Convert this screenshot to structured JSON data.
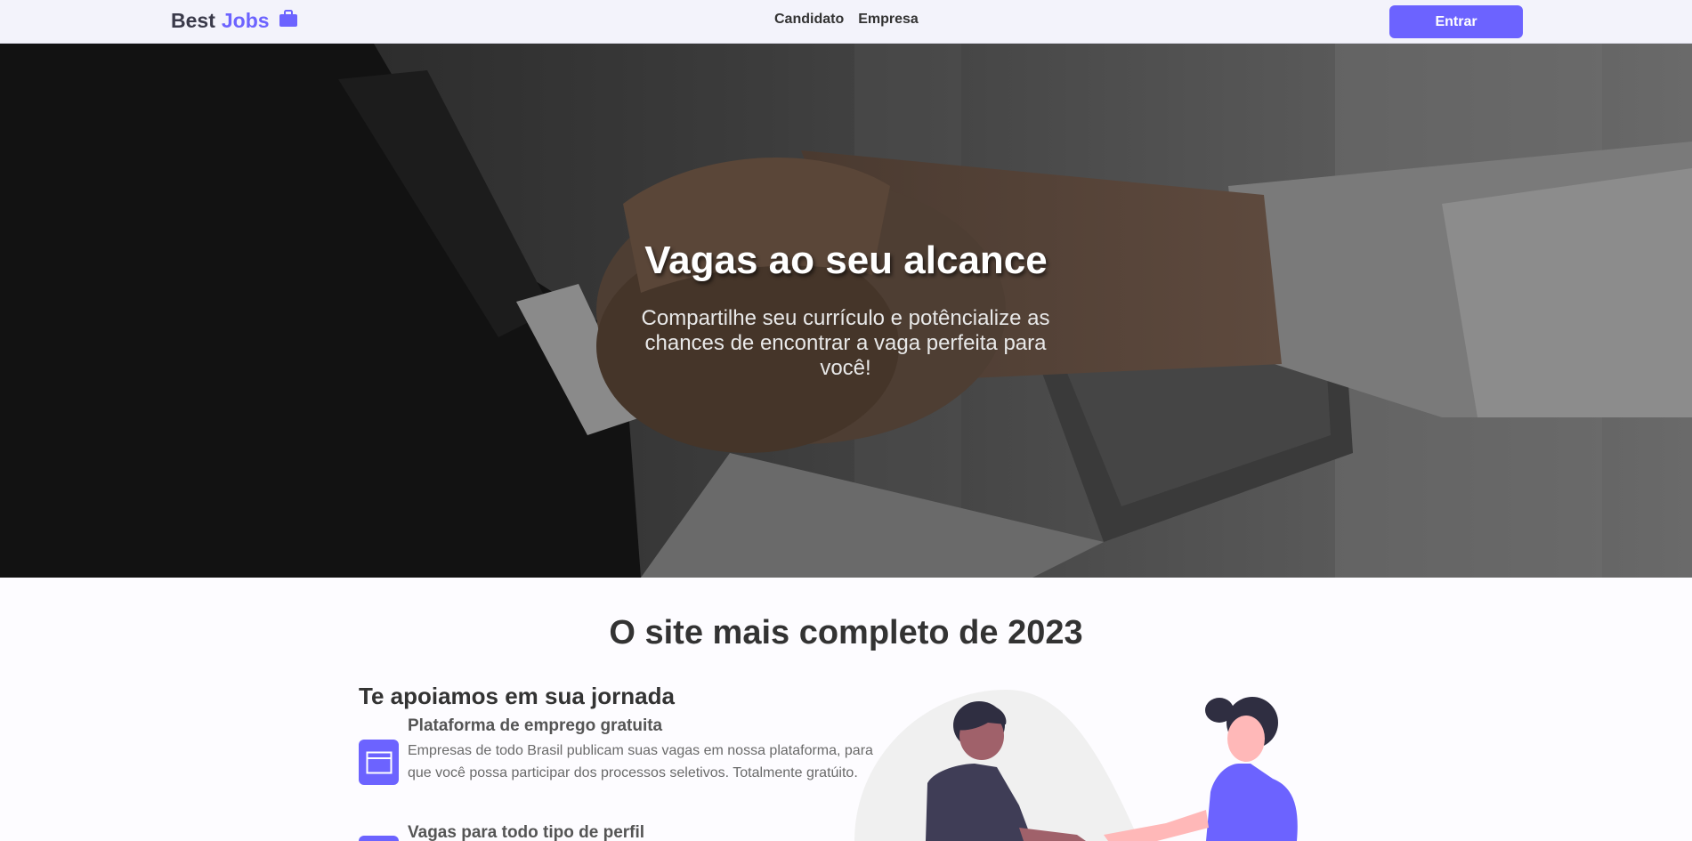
{
  "navbar": {
    "logo_best": "Best",
    "logo_jobs": "Jobs",
    "links": [
      "Candidato",
      "Empresa"
    ],
    "login_label": "Entrar"
  },
  "hero": {
    "title": "Vagas ao seu alcance",
    "subtitle": "Compartilhe seu currículo e potêncialize as chances de encontrar a vaga perfeita para você!"
  },
  "section": {
    "title": "O site mais completo de 2023",
    "subheading": "Te apoiamos em sua jornada",
    "features": [
      {
        "title": "Plataforma de emprego gratuita",
        "description": "Empresas de todo Brasil publicam suas vagas em nossa plataforma, para que você possa participar dos processos seletivos. Totalmente gratúito.",
        "icon": "browser-window-icon"
      },
      {
        "title": "Vagas para todo tipo de perfil",
        "description": "",
        "icon": "profile-icon"
      }
    ]
  },
  "colors": {
    "accent": "#6c63ff",
    "navbar_bg": "#f3f3fb",
    "text_dark": "#333333"
  }
}
